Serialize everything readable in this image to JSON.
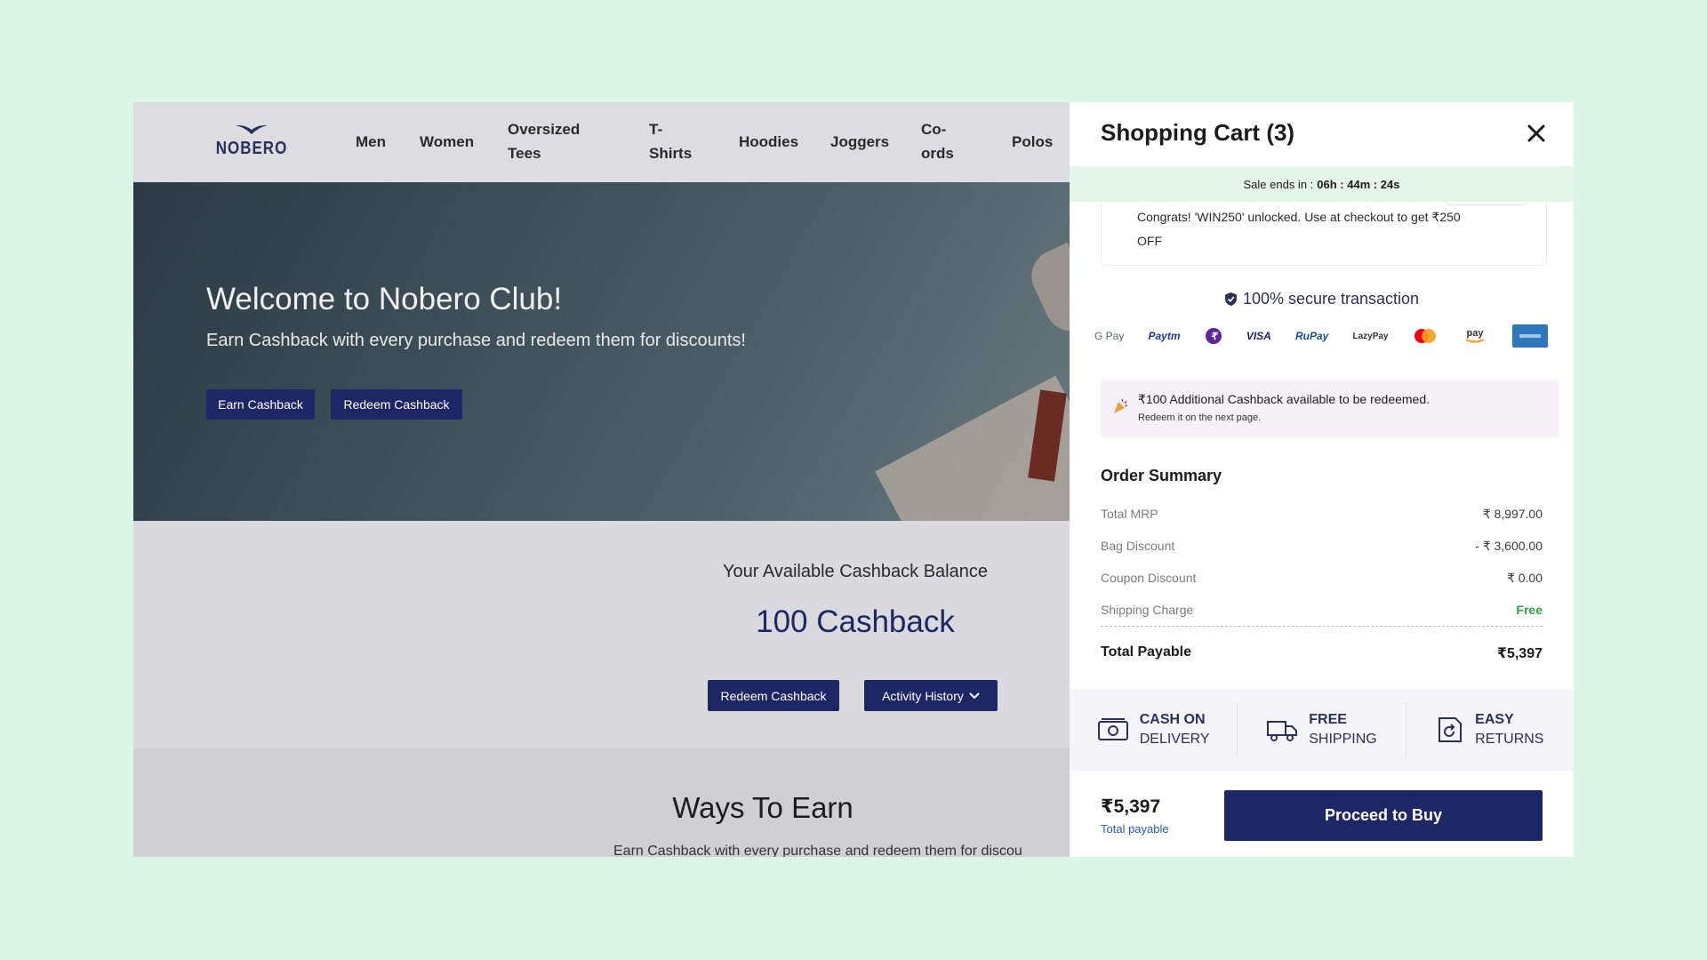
{
  "brand": {
    "logo_text": "NOBERO"
  },
  "nav": {
    "items": [
      {
        "label": "Men"
      },
      {
        "label": "Women"
      },
      {
        "label": "Oversized Tees"
      },
      {
        "label": "T-Shirts"
      },
      {
        "label": "Hoodies"
      },
      {
        "label": "Joggers"
      },
      {
        "label": "Co-ords"
      },
      {
        "label": "Polos"
      }
    ]
  },
  "hero": {
    "title": "Welcome to Nobero Club!",
    "subtitle": "Earn Cashback with every purchase and redeem them for discounts!",
    "earn_button": "Earn Cashback",
    "redeem_button": "Redeem Cashback"
  },
  "balance": {
    "label": "Your Available Cashback Balance",
    "value": "100 Cashback",
    "redeem_button": "Redeem Cashback",
    "history_button": "Activity History"
  },
  "ways": {
    "title": "Ways To Earn",
    "subtitle": "Earn Cashback with every purchase and redeem them for discou"
  },
  "cart": {
    "title": "Shopping Cart (3)",
    "sale_label": "Sale ends in :",
    "sale_timer": "06h : 44m : 24s",
    "coupon_text": "Congrats! 'WIN250' unlocked. Use at checkout to get ₹250 OFF",
    "secure_text": "100% secure transaction",
    "payment_methods": [
      "G Pay",
      "Paytm",
      "PhonePe",
      "VISA",
      "RuPay",
      "LazyPay",
      "Mastercard",
      "Amazon Pay",
      "Amex"
    ],
    "cashback_main": "₹100 Additional Cashback available to be redeemed.",
    "cashback_note": "Redeem it on the next page.",
    "order_summary": {
      "title": "Order Summary",
      "rows": [
        {
          "label": "Total MRP",
          "value": "₹ 8,997.00"
        },
        {
          "label": "Bag Discount",
          "value": "- ₹ 3,600.00"
        },
        {
          "label": "Coupon Discount",
          "value": "₹ 0.00"
        },
        {
          "label": "Shipping Charge",
          "value": "Free"
        }
      ],
      "total_label": "Total Payable",
      "total_value": "₹5,397"
    },
    "perks": [
      {
        "line1": "CASH ON",
        "line2": "DELIVERY"
      },
      {
        "line1": "FREE",
        "line2": "SHIPPING"
      },
      {
        "line1": "EASY",
        "line2": "RETURNS"
      }
    ],
    "footer": {
      "price": "₹5,397",
      "price_label": "Total payable",
      "proceed_button": "Proceed to Buy"
    }
  },
  "colors": {
    "background": "#dbf6e5",
    "brand_navy": "#1d2766",
    "free_green": "#2fa34a",
    "sale_bar": "#e3f6e9"
  }
}
